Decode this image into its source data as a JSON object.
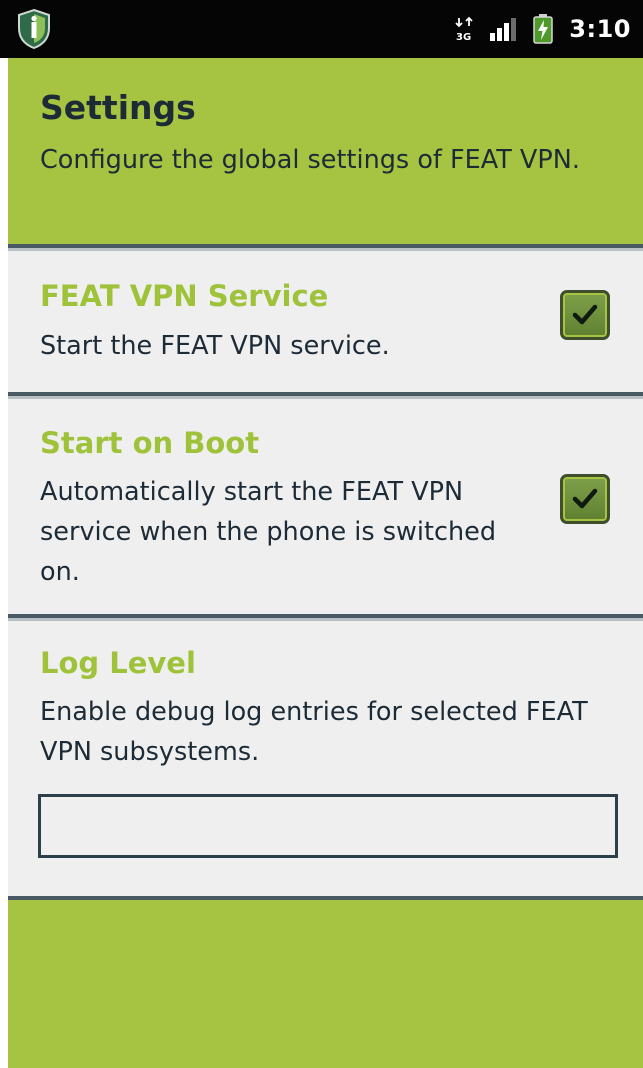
{
  "status_bar": {
    "time": "3:10",
    "network_icon": "network-3g-icon",
    "signal_icon": "signal-strength-icon",
    "battery_icon": "battery-charging-icon",
    "app_icon": "shield-app-icon"
  },
  "header": {
    "title": "Settings",
    "subtitle": "Configure the global settings of FEAT VPN."
  },
  "preferences": [
    {
      "title": "FEAT VPN Service",
      "summary": "Start the FEAT VPN service.",
      "checked": true
    },
    {
      "title": "Start on Boot",
      "summary": "Automatically start the FEAT VPN service when the phone is switched on.",
      "checked": true
    },
    {
      "title": "Log Level",
      "summary": "Enable debug log entries for selected FEAT VPN subsystems.",
      "value": ""
    }
  ],
  "colors": {
    "accent_green": "#a6c442",
    "title_green": "#9ec23a",
    "text_dark": "#1d2b37",
    "row_background": "#efefef"
  }
}
